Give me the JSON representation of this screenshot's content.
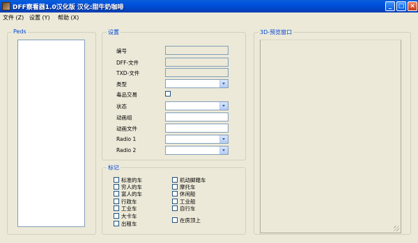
{
  "window": {
    "title": "DFF察看器1.0汉化版 汉化:甜牛奶咖啡"
  },
  "menu": [
    "文件 (Z)",
    "设置 (Y)",
    "帮助 (X)"
  ],
  "peds_group": {
    "title": "Peds"
  },
  "settings_group": {
    "title": "设置",
    "fields": {
      "id_label": "编号",
      "dff_label": "DFF-文件",
      "txd_label": "TXD-文件",
      "type_label": "类型",
      "drug_label": "毒品交易",
      "state_label": "状态",
      "anim_group_label": "动画组",
      "anim_file_label": "动画文件",
      "radio1_label": "Radio 1",
      "radio2_label": "Radio 2"
    }
  },
  "flags_group": {
    "title": "标记",
    "left": [
      "标准的车",
      "穷人的车",
      "富人的车",
      "行政车",
      "工业车",
      "大卡车",
      "出租车"
    ],
    "right": [
      "机动脚踏车",
      "摩托车",
      "休闲船",
      "工业船",
      "自行车",
      "在房顶上"
    ]
  },
  "preview_group": {
    "title": "3D-预览窗口"
  }
}
